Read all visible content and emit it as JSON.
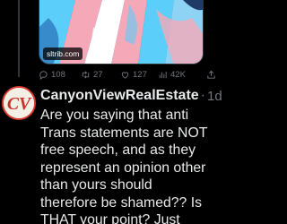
{
  "tweet_card": {
    "source_domain": "sltrib.com"
  },
  "actions": {
    "reply_count": "108",
    "retweet_count": "27",
    "like_count": "127",
    "view_count": "42K"
  },
  "reply": {
    "author_name": "CanyonViewRealEstate",
    "separator": "·",
    "timestamp": "1d",
    "text": "Are you saying that anti\nTrans statements are NOT\nfree speech, and as they\nrepresent an opinion other\nthan yours should\ntherefore be shamed?? Is\nTHAT your point? Just"
  },
  "colors": {
    "background": "#000000",
    "text_primary": "#e7e9ea",
    "text_secondary": "#71767b",
    "flag_blue": "#5bcefa",
    "flag_pink": "#f5a9b8",
    "avatar_accent": "#d83a2e"
  }
}
